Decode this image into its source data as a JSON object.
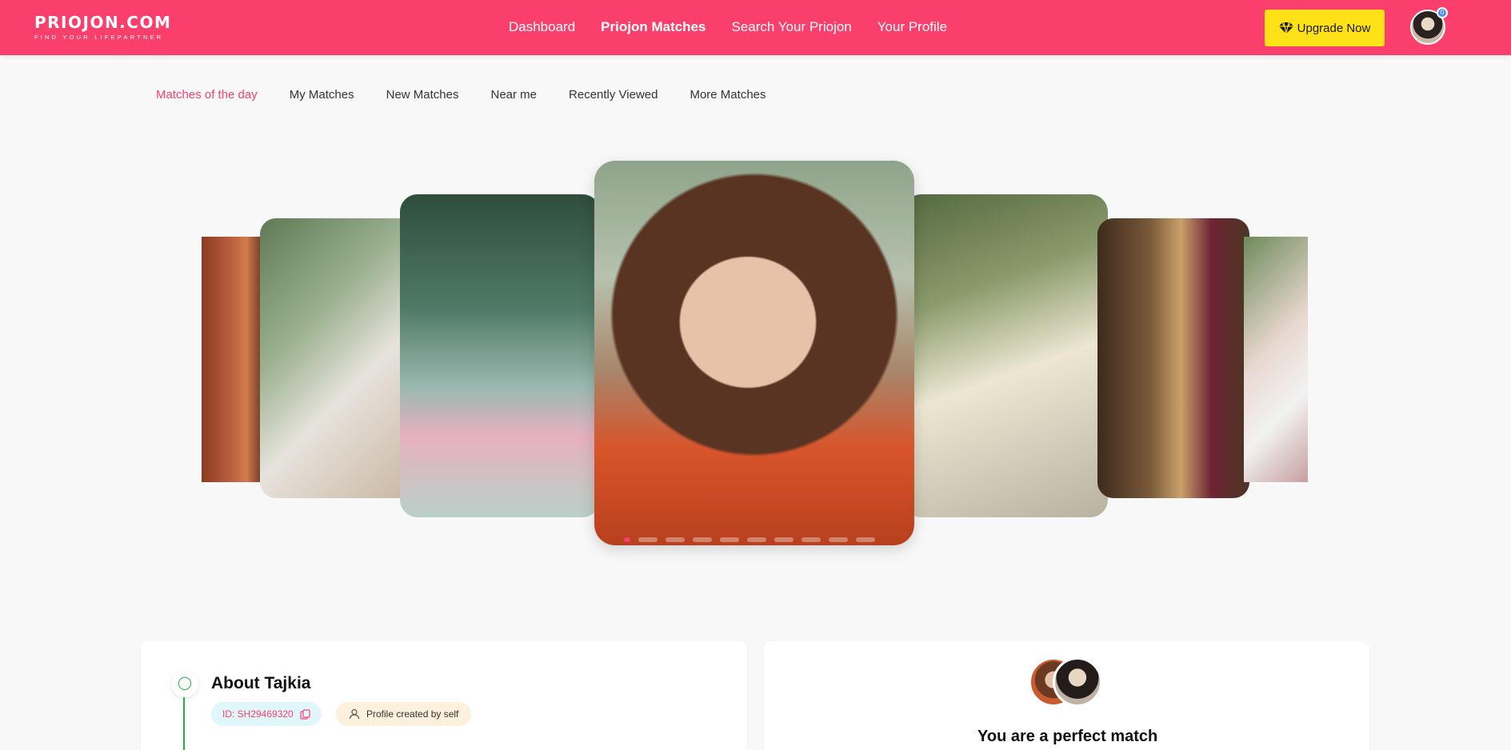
{
  "brand": {
    "name": "PRIOJON.COM",
    "tagline": "FIND YOUR LIFEPARTNER"
  },
  "nav": {
    "items": [
      {
        "label": "Dashboard",
        "active": false
      },
      {
        "label": "Priojon Matches",
        "active": true
      },
      {
        "label": "Search Your Priojon",
        "active": false
      },
      {
        "label": "Your Profile",
        "active": false
      }
    ]
  },
  "header": {
    "upgrade_label": "Upgrade Now",
    "upgrade_icon": "diamond-icon",
    "notification_count": "0"
  },
  "subnav": {
    "items": [
      {
        "label": "Matches of the day",
        "active": true
      },
      {
        "label": "My Matches",
        "active": false
      },
      {
        "label": "New Matches",
        "active": false
      },
      {
        "label": "Near me",
        "active": false
      },
      {
        "label": "Recently Viewed",
        "active": false
      },
      {
        "label": "More Matches",
        "active": false
      }
    ]
  },
  "carousel": {
    "active_index": 0,
    "dot_count": 10
  },
  "about": {
    "title": "About Tajkia",
    "id_label": "ID: SH29469320",
    "created_label": "Profile created by self"
  },
  "match": {
    "text": "You are a perfect match"
  },
  "colors": {
    "primary": "#fb3f6c",
    "upgrade": "#ffe117",
    "accent_green": "#22b04b"
  }
}
